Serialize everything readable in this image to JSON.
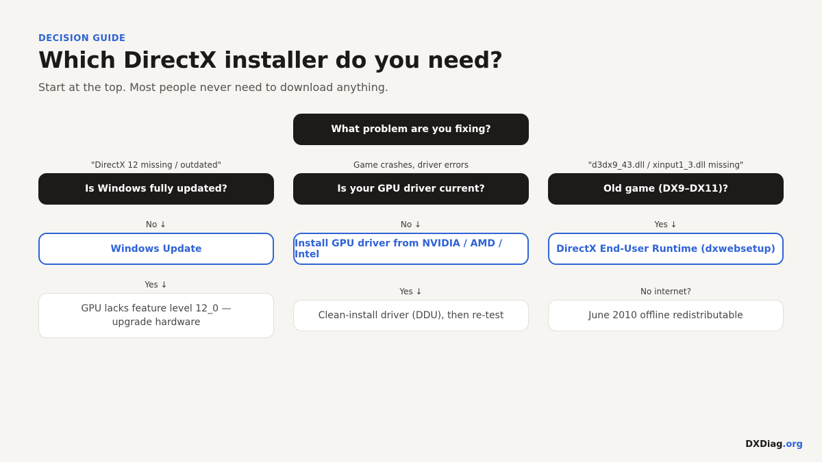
{
  "header": {
    "eyebrow": "DECISION GUIDE",
    "title": "Which DirectX installer do you need?",
    "subtitle": "Start at the top. Most people never need to download anything."
  },
  "root": {
    "label": "What problem are you fixing?"
  },
  "branches": [
    {
      "trigger": "\"DirectX 12 missing / outdated\"",
      "question": "Is Windows fully updated?",
      "edge1": "No ↓",
      "action": "Windows Update",
      "edge2": "Yes ↓",
      "outcome": "GPU lacks feature level 12_0 — upgrade hardware"
    },
    {
      "trigger": "Game crashes, driver errors",
      "question": "Is your GPU driver current?",
      "edge1": "No ↓",
      "action": "Install GPU driver from NVIDIA / AMD / Intel",
      "edge2": "Yes ↓",
      "outcome": "Clean-install driver (DDU), then re-test"
    },
    {
      "trigger": "\"d3dx9_43.dll / xinput1_3.dll missing\"",
      "question": "Old game (DX9–DX11)?",
      "edge1": "Yes ↓",
      "action": "DirectX End-User Runtime (dxwebsetup)",
      "edge2": "No internet?",
      "outcome": "June 2010 offline redistributable"
    }
  ],
  "brand": {
    "name": "DXDiag",
    "tld": ".org"
  },
  "colors": {
    "accent": "#2f63d6",
    "dark_node": "#1e1a19",
    "background": "#f6f5f2"
  }
}
